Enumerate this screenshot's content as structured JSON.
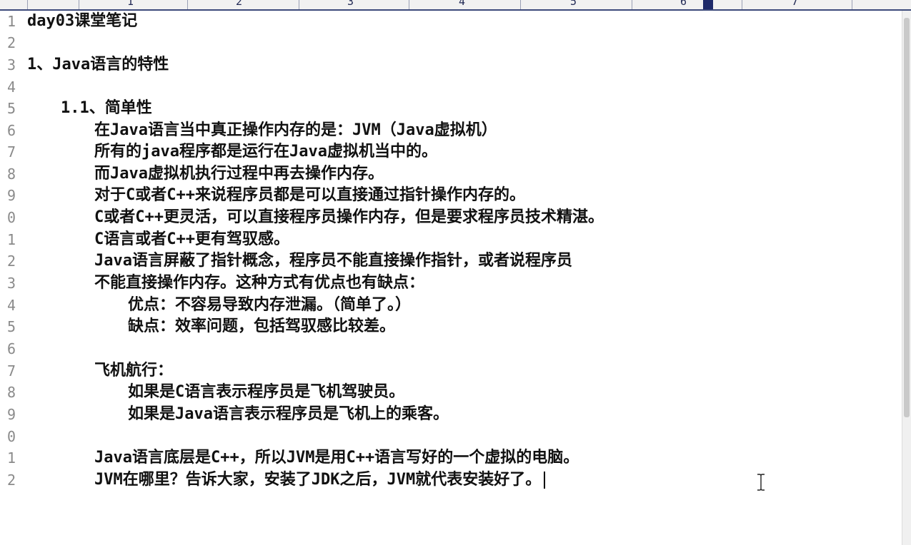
{
  "ruler": {
    "numbers": [
      "1",
      "2",
      "3",
      "4",
      "5",
      "6",
      "7"
    ]
  },
  "lines": [
    {
      "no": "1",
      "text": "day03课堂笔记"
    },
    {
      "no": "2",
      "text": ""
    },
    {
      "no": "3",
      "text": "1、Java语言的特性"
    },
    {
      "no": "4",
      "text": ""
    },
    {
      "no": "5",
      "text": "1.1、简单性"
    },
    {
      "no": "6",
      "text": "在Java语言当中真正操作内存的是：JVM（Java虚拟机）"
    },
    {
      "no": "7",
      "text": "所有的java程序都是运行在Java虚拟机当中的。"
    },
    {
      "no": "8",
      "text": "而Java虚拟机执行过程中再去操作内存。"
    },
    {
      "no": "9",
      "text": "对于C或者C++来说程序员都是可以直接通过指针操作内存的。"
    },
    {
      "no": "0",
      "text": "C或者C++更灵活，可以直接程序员操作内存，但是要求程序员技术精湛。"
    },
    {
      "no": "1",
      "text": "C语言或者C++更有驾驭感。"
    },
    {
      "no": "2",
      "text": "Java语言屏蔽了指针概念，程序员不能直接操作指针，或者说程序员"
    },
    {
      "no": "3",
      "text": "不能直接操作内存。这种方式有优点也有缺点："
    },
    {
      "no": "4",
      "text": "优点：不容易导致内存泄漏。（简单了。）"
    },
    {
      "no": "5",
      "text": "缺点：效率问题，包括驾驭感比较差。"
    },
    {
      "no": "6",
      "text": ""
    },
    {
      "no": "7",
      "text": "飞机航行："
    },
    {
      "no": "8",
      "text": "如果是C语言表示程序员是飞机驾驶员。"
    },
    {
      "no": "9",
      "text": "如果是Java语言表示程序员是飞机上的乘客。"
    },
    {
      "no": "0",
      "text": ""
    },
    {
      "no": "1",
      "text": "Java语言底层是C++，所以JVM是用C++语言写好的一个虚拟的电脑。"
    },
    {
      "no": "2",
      "text": "JVM在哪里？告诉大家，安装了JDK之后，JVM就代表安装好了。"
    }
  ],
  "icons": {
    "mouse_cursor": "i-beam-cursor-icon"
  }
}
